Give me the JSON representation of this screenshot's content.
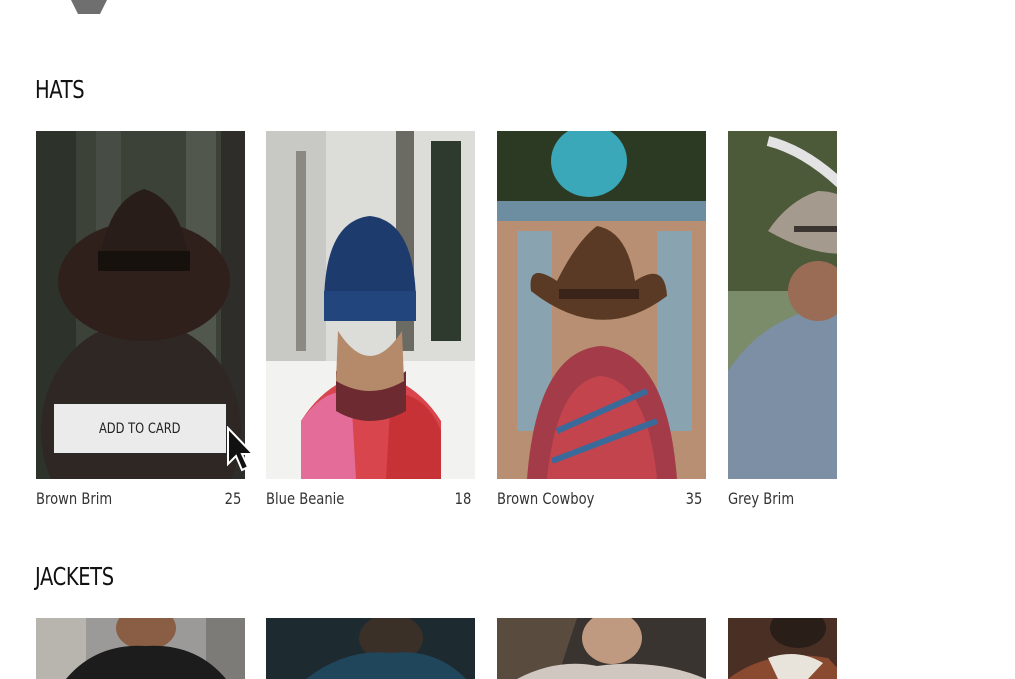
{
  "header": {
    "logo_icon": "hexagon-logo-icon"
  },
  "sections": [
    {
      "title": "HATS",
      "products": [
        {
          "name": "Brown Brim",
          "price": "25",
          "image": "brown-brim-hat-photo",
          "hover_button": "ADD TO CARD"
        },
        {
          "name": "Blue Beanie",
          "price": "18",
          "image": "blue-beanie-photo"
        },
        {
          "name": "Brown Cowboy",
          "price": "35",
          "image": "brown-cowboy-hat-photo"
        },
        {
          "name": "Grey Brim",
          "price": "",
          "image": "grey-brim-hat-photo"
        }
      ]
    },
    {
      "title": "JACKETS",
      "products": [
        {
          "image": "jacket-photo-1"
        },
        {
          "image": "jacket-photo-2"
        },
        {
          "image": "jacket-photo-3"
        },
        {
          "image": "jacket-photo-4"
        }
      ]
    }
  ],
  "cursor": "arrow-cursor-icon"
}
